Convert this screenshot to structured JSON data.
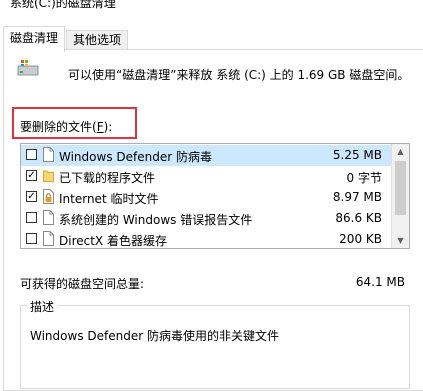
{
  "window": {
    "title": "系统(C:)的磁盘清理"
  },
  "tabs": [
    {
      "label": "磁盘清理",
      "active": true
    },
    {
      "label": "其他选项",
      "active": false
    }
  ],
  "info_text": "可以使用“磁盘清理”来释放 系统 (C:) 上的 1.69 GB 磁盘空间。",
  "files_label": {
    "text": "要删除的文件(",
    "accel": "F",
    "suffix": "):"
  },
  "files": [
    {
      "name": "Windows Defender 防病毒",
      "size": "5.25 MB",
      "checked": false,
      "selected": true,
      "icon": "blank-file-icon"
    },
    {
      "name": "已下载的程序文件",
      "size": "0 字节",
      "checked": true,
      "selected": false,
      "icon": "folder-icon"
    },
    {
      "name": "Internet 临时文件",
      "size": "8.97 MB",
      "checked": true,
      "selected": false,
      "icon": "lock-file-icon"
    },
    {
      "name": "系统创建的 Windows 错误报告文件",
      "size": "86.6 KB",
      "checked": false,
      "selected": false,
      "icon": "blank-file-icon"
    },
    {
      "name": "DirectX 着色器缓存",
      "size": "200 KB",
      "checked": false,
      "selected": false,
      "icon": "blank-file-icon"
    }
  ],
  "total": {
    "label": "可获得的磁盘空间总量:",
    "value": "64.1 MB"
  },
  "description": {
    "legend": "描述",
    "text": "Windows Defender 防病毒使用的非关键文件"
  },
  "colors": {
    "selection": "#cce8ff",
    "highlight_border": "#d9363e"
  }
}
